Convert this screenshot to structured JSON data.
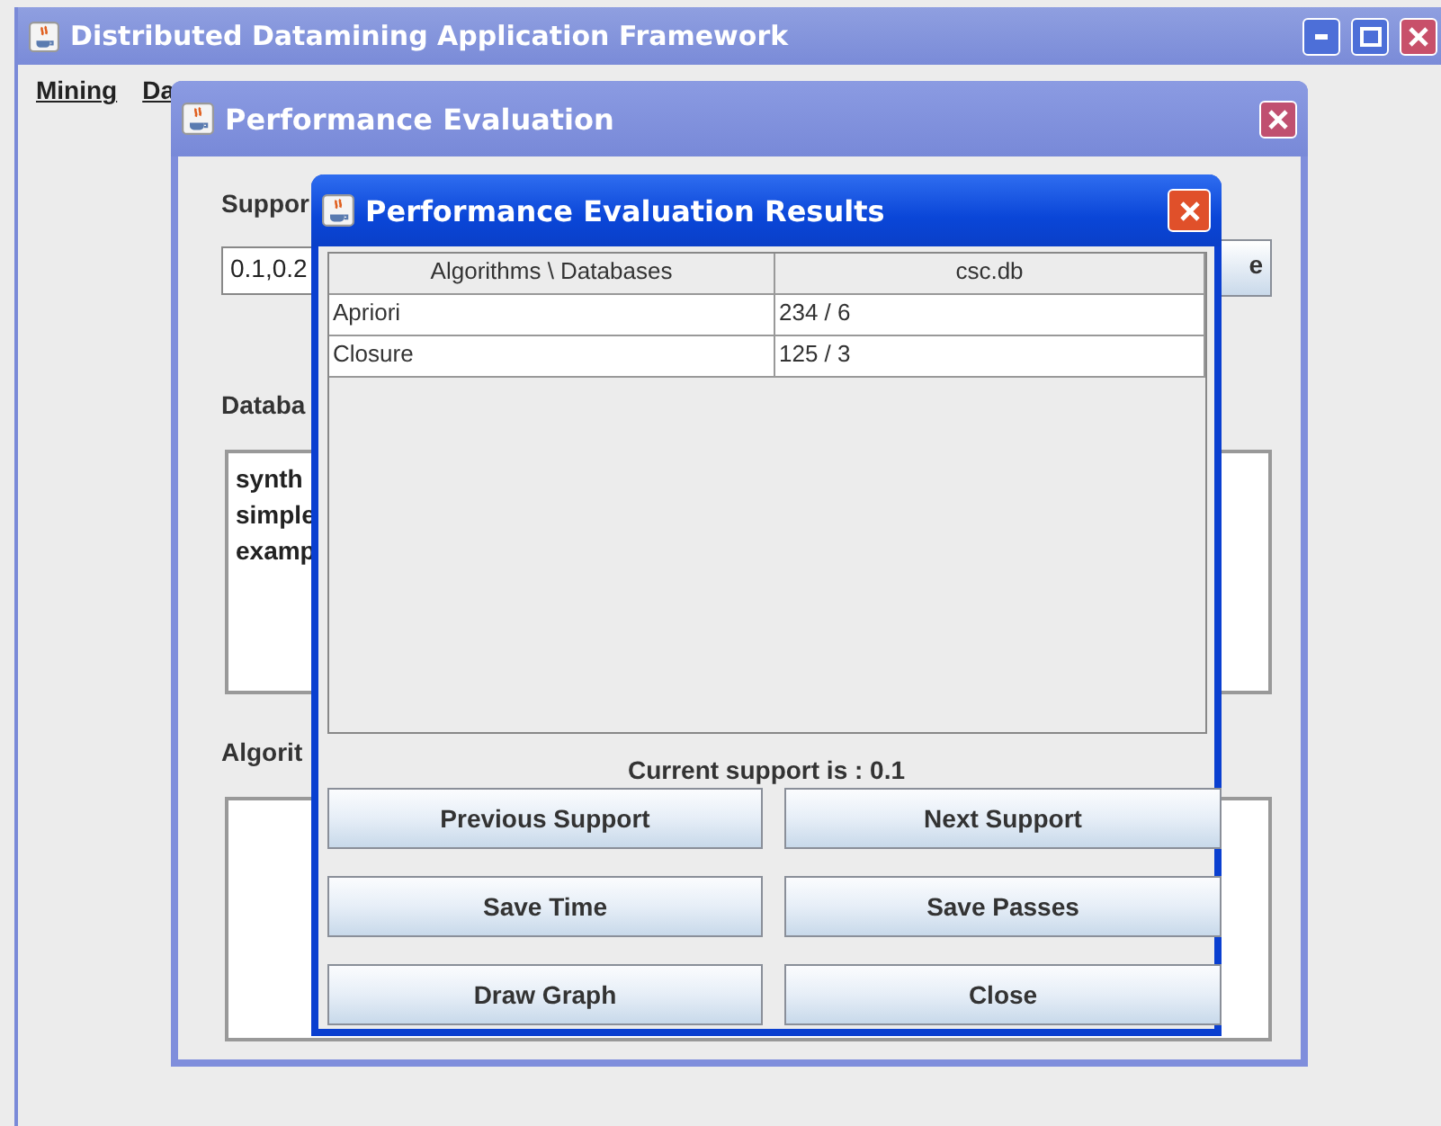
{
  "main_window": {
    "title": "Distributed Datamining Application Framework",
    "menu": [
      {
        "label": "Mining"
      },
      {
        "label": "Da"
      }
    ]
  },
  "evaluation_dialog": {
    "title": "Performance Evaluation",
    "support_label": "Suppor",
    "support_value": "0.1,0.2",
    "support_button": "e",
    "databases_label": "Databa",
    "databases": [
      "synth",
      "simple",
      "examp"
    ],
    "algorithms_label": "Algorit"
  },
  "results_dialog": {
    "title": "Performance Evaluation Results",
    "table": {
      "columns": [
        "Algorithms \\ Databases",
        "csc.db"
      ],
      "rows": [
        [
          "Apriori",
          "234 / 6"
        ],
        [
          "Closure",
          "125 / 3"
        ]
      ]
    },
    "status": "Current support is :  0.1",
    "buttons": [
      "Previous Support",
      "Next Support",
      "Save Time",
      "Save Passes",
      "Draw Graph",
      "Close"
    ]
  }
}
